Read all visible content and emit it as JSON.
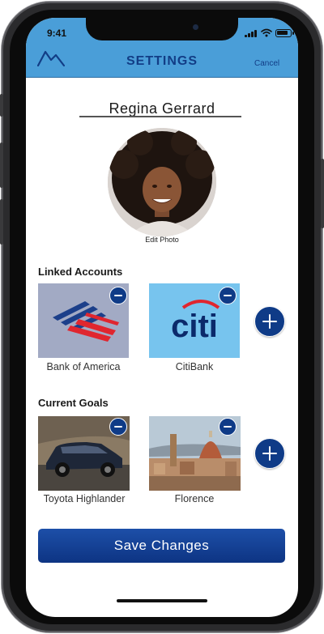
{
  "status_bar": {
    "time": "9:41"
  },
  "header": {
    "logo_icon": "mountain-logo-icon",
    "title": "SETTINGS",
    "cancel_label": "Cancel",
    "background": "#4a9ed8",
    "accent": "#123d86"
  },
  "profile": {
    "name": "Regina Gerrard",
    "edit_photo_label": "Edit Photo"
  },
  "linked_accounts": {
    "title": "Linked Accounts",
    "items": [
      {
        "label": "Bank of America",
        "logo": "bank-of-america-flag-logo"
      },
      {
        "label": "CitiBank",
        "logo": "citi-logo",
        "logo_text": "citi"
      }
    ],
    "add_icon": "plus-icon",
    "remove_icon": "minus-icon"
  },
  "current_goals": {
    "title": "Current Goals",
    "items": [
      {
        "label": "Toyota Highlander",
        "image": "suv-photo"
      },
      {
        "label": "Florence",
        "image": "florence-cityscape-photo"
      }
    ],
    "add_icon": "plus-icon",
    "remove_icon": "minus-icon"
  },
  "footer": {
    "save_label": "Save Changes",
    "primary_color": "#0f3b87"
  }
}
